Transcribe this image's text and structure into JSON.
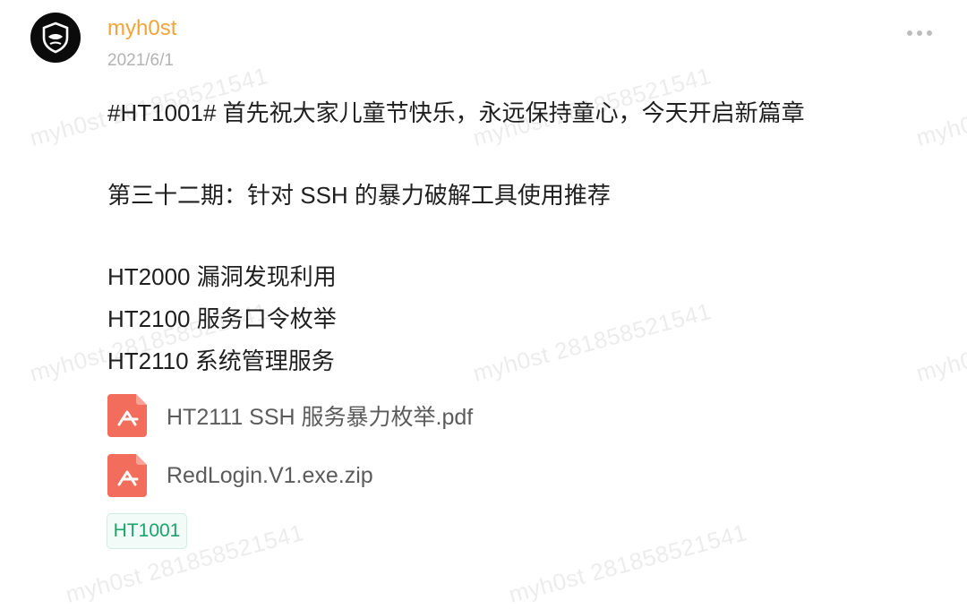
{
  "post": {
    "author": "myh0st",
    "date": "2021/6/1",
    "more_icon": "ellipsis-icon",
    "lines": [
      "#HT1001# 首先祝大家儿童节快乐，永远保持童心，今天开启新篇章",
      "第三十二期：针对 SSH 的暴力破解工具使用推荐",
      "HT2000 漏洞发现利用",
      "HT2100 服务口令枚举",
      "HT2110 系统管理服务"
    ],
    "attachments": [
      {
        "name": "HT2111 SSH 服务暴力枚举.pdf",
        "icon": "pdf-file-icon"
      },
      {
        "name": "RedLogin.V1.exe.zip",
        "icon": "pdf-file-icon"
      }
    ],
    "tag": "HT1001"
  },
  "watermark": {
    "text": "myh0st 281858521541"
  },
  "colors": {
    "author": "#f0a43a",
    "file_icon": "#f26d5b",
    "tag_text": "#1aa36b",
    "tag_bg": "#f2fbf7"
  }
}
